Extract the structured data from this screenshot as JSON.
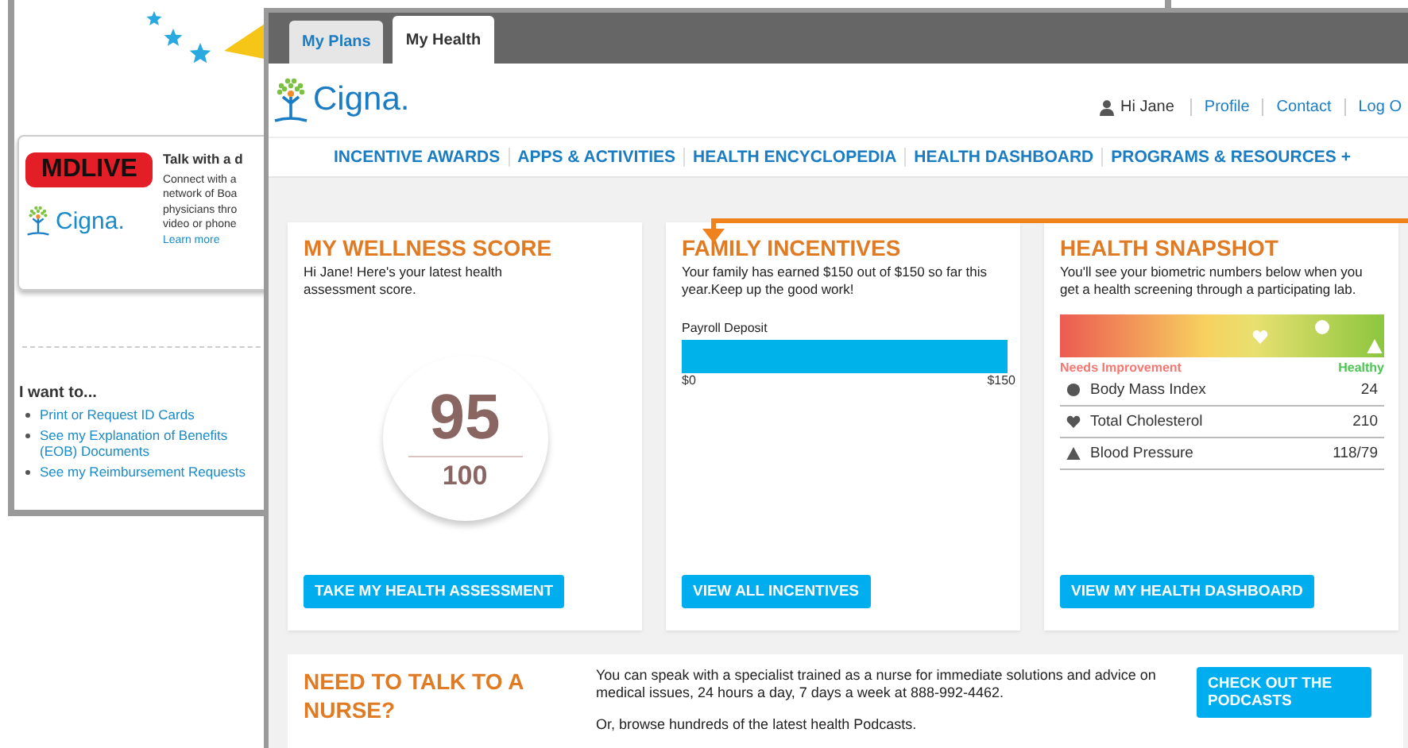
{
  "background_window": {
    "promo": {
      "logo": "MDLIVE",
      "offered_by": "Cigna.",
      "title": "Talk with a d",
      "lines": [
        "Connect with a",
        "network of Boa",
        "physicians thro",
        "video or phone"
      ],
      "link": "Learn more"
    },
    "i_want_to": {
      "heading": "I want to...",
      "links": [
        "Print or Request ID Cards",
        "See my Explanation of Benefits (EOB) Documents",
        "See my Reimbursement Requests"
      ]
    }
  },
  "window": {
    "tabs": [
      {
        "label": "My Plans",
        "selected": false
      },
      {
        "label": "My Health",
        "selected": true
      }
    ],
    "brand": "Cigna.",
    "user": {
      "greeting": "Hi Jane",
      "links": [
        "Profile",
        "Contact",
        "Log O"
      ]
    },
    "nav": [
      "INCENTIVE AWARDS",
      "APPS & ACTIVITIES",
      "HEALTH ENCYCLOPEDIA",
      "HEALTH DASHBOARD",
      "PROGRAMS & RESOURCES +"
    ],
    "wellness": {
      "title": "MY WELLNESS SCORE",
      "text": "Hi Jane! Here's your latest health assessment score.",
      "score": "95",
      "out_of": "100",
      "button": "TAKE MY HEALTH ASSESSMENT"
    },
    "incentives": {
      "title": "FAMILY INCENTIVES",
      "text": "Your family has earned $150 out of $150 so far this year.Keep up the good work!",
      "bar_label": "Payroll Deposit",
      "level": 1,
      "min": "$0",
      "max": "$150",
      "button": "VIEW ALL INCENTIVES"
    },
    "snapshot": {
      "title": "HEALTH SNAPSHOT",
      "text": "You'll see your biometric numbers below when you get a health screening through a participating lab.",
      "low_label": "Needs Improvement",
      "high_label": "Healthy",
      "metrics": [
        {
          "kind": "circle",
          "name": "Body Mass Index",
          "value": "24",
          "level": 0.81
        },
        {
          "kind": "heart",
          "name": "Total Cholesterol",
          "value": "210",
          "level": 0.62
        },
        {
          "kind": "triangle",
          "name": "Blood Pressure",
          "value": "118/79",
          "level": 0.97
        }
      ],
      "button": "VIEW MY HEALTH DASHBOARD"
    },
    "nurse": {
      "title": "NEED TO TALK TO A NURSE?",
      "paragraphs": [
        "You can speak with a specialist trained as a nurse for immediate solutions and advice on medical issues, 24 hours a day, 7 days a week at 888-992-4462.",
        "Or, browse hundreds of the latest health Podcasts."
      ],
      "button": "CHECK OUT THE PODCASTS"
    }
  }
}
